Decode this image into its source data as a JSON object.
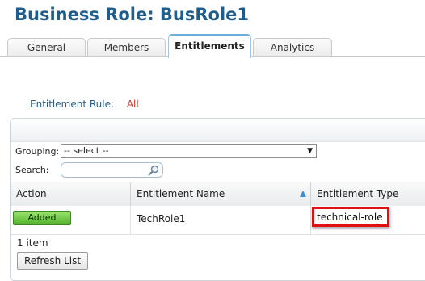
{
  "page": {
    "title": "Business Role: BusRole1"
  },
  "tabs": [
    {
      "label": "General",
      "active": false
    },
    {
      "label": "Members",
      "active": false
    },
    {
      "label": "Entitlements",
      "active": true
    },
    {
      "label": "Analytics",
      "active": false
    }
  ],
  "entitlement_rule": {
    "label": "Entitlement Rule:",
    "value": "All"
  },
  "filters": {
    "grouping_label": "Grouping:",
    "grouping_value": "-- select --",
    "search_label": "Search:",
    "search_value": ""
  },
  "table": {
    "columns": [
      "Action",
      "Entitlement Name",
      "Entitlement Type"
    ],
    "sorted_column": "Entitlement Name",
    "sort_direction": "ascending",
    "rows": [
      {
        "action": "Added",
        "name": "TechRole1",
        "type": "technical-role"
      }
    ]
  },
  "footer": {
    "item_count": "1 item",
    "refresh_label": "Refresh List"
  },
  "colors": {
    "title": "#1f5e8c",
    "rule_value": "#c0392b",
    "added_button": "#6ccb3f",
    "highlight_border": "#e01010"
  }
}
